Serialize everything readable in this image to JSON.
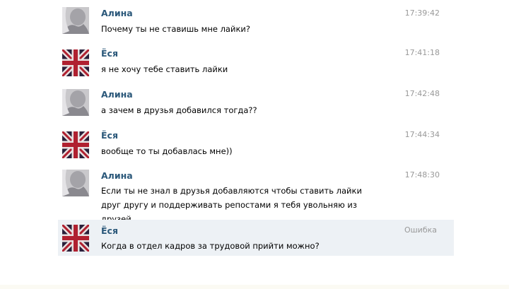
{
  "messages": [
    {
      "author": "Алина",
      "avatar": "alina-avatar",
      "time": "17:39:42",
      "text": "Почему ты не ставишь мне лайки?"
    },
    {
      "author": "Ёся",
      "avatar": "uk-flag-avatar",
      "time": "17:41:18",
      "text": "я не хочу тебе ставить лайки"
    },
    {
      "author": "Алина",
      "avatar": "alina-avatar",
      "time": "17:42:48",
      "text": "а зачем в друзья добавился тогда??"
    },
    {
      "author": "Ёся",
      "avatar": "uk-flag-avatar",
      "time": "17:44:34",
      "text": "вообще то ты добавлась мне))"
    },
    {
      "author": "Алина",
      "avatar": "alina-avatar",
      "time": "17:48:30",
      "text": "Если ты не знал в друзья добавляются чтобы ставить лайки друг другу и поддерживать репостами я тебя увольняю из друзей"
    },
    {
      "author": "Ёся",
      "avatar": "uk-flag-avatar",
      "time": "Ошибка",
      "text": "Когда в отдел кадров за трудовой прийти можно?",
      "status": "error"
    }
  ],
  "colors": {
    "author": "#2b587a",
    "time": "#999999",
    "error_background": "#edf1f5"
  }
}
